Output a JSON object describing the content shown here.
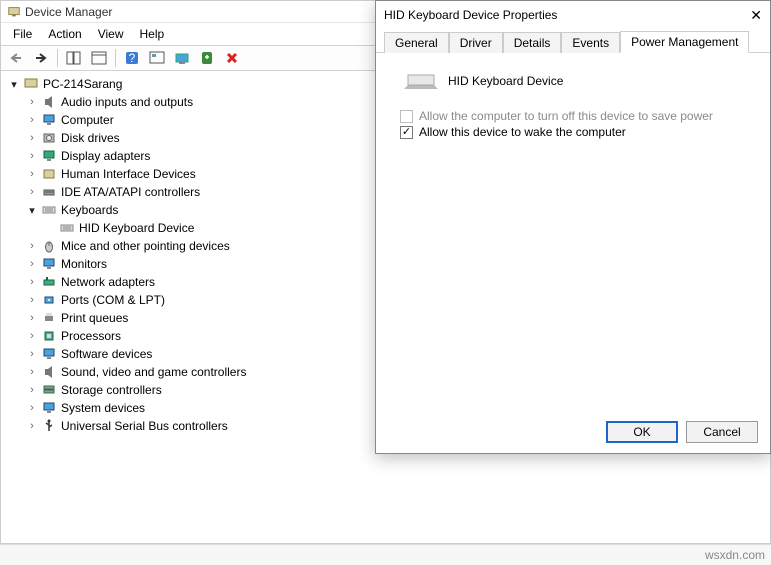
{
  "main": {
    "title": "Device Manager",
    "menu": {
      "file": "File",
      "action": "Action",
      "view": "View",
      "help": "Help"
    },
    "root": "PC-214Sarang",
    "categories": [
      {
        "label": "Audio inputs and outputs",
        "icon": "speaker"
      },
      {
        "label": "Computer",
        "icon": "monitor"
      },
      {
        "label": "Disk drives",
        "icon": "disk"
      },
      {
        "label": "Display adapters",
        "icon": "display"
      },
      {
        "label": "Human Interface Devices",
        "icon": "hid"
      },
      {
        "label": "IDE ATA/ATAPI controllers",
        "icon": "ide"
      },
      {
        "label": "Keyboards",
        "icon": "kbd",
        "open": true,
        "children": [
          {
            "label": "HID Keyboard Device",
            "icon": "kbd"
          }
        ]
      },
      {
        "label": "Mice and other pointing devices",
        "icon": "mouse"
      },
      {
        "label": "Monitors",
        "icon": "monitor"
      },
      {
        "label": "Network adapters",
        "icon": "net"
      },
      {
        "label": "Ports (COM & LPT)",
        "icon": "port"
      },
      {
        "label": "Print queues",
        "icon": "print"
      },
      {
        "label": "Processors",
        "icon": "cpu"
      },
      {
        "label": "Software devices",
        "icon": "soft"
      },
      {
        "label": "Sound, video and game controllers",
        "icon": "speaker"
      },
      {
        "label": "Storage controllers",
        "icon": "storage"
      },
      {
        "label": "System devices",
        "icon": "system"
      },
      {
        "label": "Universal Serial Bus controllers",
        "icon": "usb"
      }
    ]
  },
  "dialog": {
    "title": "HID Keyboard Device Properties",
    "tabs": {
      "general": "General",
      "driver": "Driver",
      "details": "Details",
      "events": "Events",
      "pm": "Power Management"
    },
    "device_name": "HID Keyboard Device",
    "opt_turnoff": "Allow the computer to turn off this device to save power",
    "opt_wake": "Allow this device to wake the computer",
    "ok": "OK",
    "cancel": "Cancel"
  },
  "watermark": "wsxdn.com"
}
